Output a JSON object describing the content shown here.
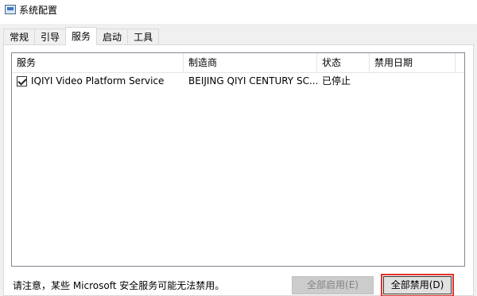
{
  "window": {
    "title": "系统配置",
    "icon": "msconfig-icon"
  },
  "tabs": [
    {
      "label": "常规",
      "active": false
    },
    {
      "label": "引导",
      "active": false
    },
    {
      "label": "服务",
      "active": true
    },
    {
      "label": "启动",
      "active": false
    },
    {
      "label": "工具",
      "active": false
    }
  ],
  "services": {
    "columns": [
      "服务",
      "制造商",
      "状态",
      "禁用日期"
    ],
    "rows": [
      {
        "checked": true,
        "service": "IQIYI Video Platform Service",
        "manufacturer": "BEIJING QIYI CENTURY SC...",
        "status": "已停止",
        "disabled_date": ""
      }
    ]
  },
  "footer": {
    "note": "请注意，某些 Microsoft 安全服务可能无法禁用。",
    "enable_all_label": "全部启用(E)",
    "disable_all_label": "全部禁用(D)",
    "highlight_color": "#e0322a"
  }
}
